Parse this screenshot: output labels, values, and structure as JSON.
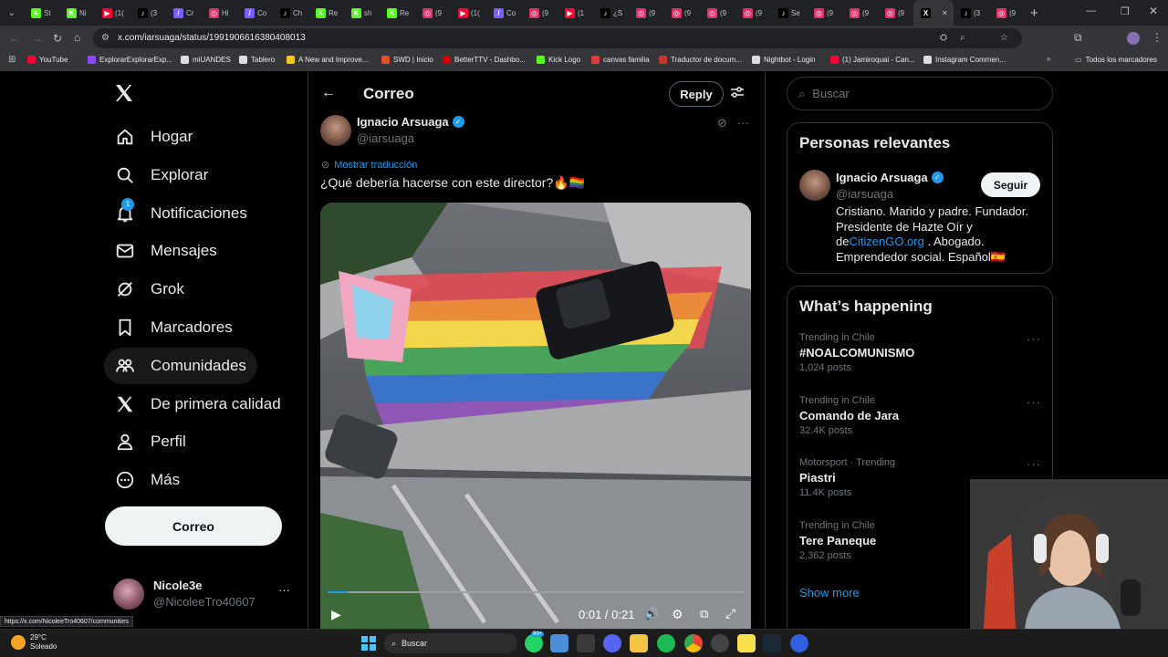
{
  "browser": {
    "tabs": [
      {
        "label": "St",
        "color": "#53fc18",
        "glyph": "K"
      },
      {
        "label": "Ni",
        "color": "#53fc18",
        "glyph": "K"
      },
      {
        "label": "(1(",
        "color": "#ff0033",
        "glyph": "▶"
      },
      {
        "label": "(3",
        "color": "#000000",
        "glyph": "♪"
      },
      {
        "label": "Cr",
        "color": "#7b5cff",
        "glyph": "/"
      },
      {
        "label": "Hi",
        "color": "#e1306c",
        "glyph": "◎"
      },
      {
        "label": "Co",
        "color": "#7b5cff",
        "glyph": "/"
      },
      {
        "label": "Ch",
        "color": "#000000",
        "glyph": "♪"
      },
      {
        "label": "Re",
        "color": "#53fc18",
        "glyph": "K"
      },
      {
        "label": "sh",
        "color": "#53fc18",
        "glyph": "K"
      },
      {
        "label": "Re",
        "color": "#53fc18",
        "glyph": "K"
      },
      {
        "label": "(9",
        "color": "#e1306c",
        "glyph": "◎"
      },
      {
        "label": "(1(",
        "color": "#ff0033",
        "glyph": "▶"
      },
      {
        "label": "Co",
        "color": "#7b5cff",
        "glyph": "/"
      },
      {
        "label": "(9",
        "color": "#e1306c",
        "glyph": "◎"
      },
      {
        "label": "(1",
        "color": "#ff0033",
        "glyph": "▶"
      },
      {
        "label": "¿S",
        "color": "#000000",
        "glyph": "♪"
      },
      {
        "label": "(9",
        "color": "#e1306c",
        "glyph": "◎"
      },
      {
        "label": "(9",
        "color": "#e1306c",
        "glyph": "◎"
      },
      {
        "label": "(9",
        "color": "#e1306c",
        "glyph": "◎"
      },
      {
        "label": "(9",
        "color": "#e1306c",
        "glyph": "◎"
      },
      {
        "label": "Se",
        "color": "#000000",
        "glyph": "♪"
      },
      {
        "label": "(9",
        "color": "#e1306c",
        "glyph": "◎"
      },
      {
        "label": "(9",
        "color": "#e1306c",
        "glyph": "◎"
      },
      {
        "label": "(9",
        "color": "#e1306c",
        "glyph": "◎"
      },
      {
        "label": "",
        "color": "#000000",
        "glyph": "X",
        "active": true
      },
      {
        "label": "(3",
        "color": "#000000",
        "glyph": "♪"
      },
      {
        "label": "(9",
        "color": "#e1306c",
        "glyph": "◎"
      }
    ],
    "url": "x.com/iarsuaga/status/1991906616380408013",
    "bookmarks": [
      {
        "label": "YouTube",
        "color": "#ff0033"
      },
      {
        "label": "ExplorarExplorarExp...",
        "color": "#9146ff"
      },
      {
        "label": "miUANDES",
        "color": "#dddddd"
      },
      {
        "label": "Tablero",
        "color": "#dddddd"
      },
      {
        "label": "A New and Improve...",
        "color": "#f5c518"
      },
      {
        "label": "SWD | Inicio",
        "color": "#e34f26"
      },
      {
        "label": "BetterTTV - Dashbo...",
        "color": "#d50000"
      },
      {
        "label": "Kick Logo",
        "color": "#53fc18"
      },
      {
        "label": "canvas familia",
        "color": "#e13a3a"
      },
      {
        "label": "Traductor de docum...",
        "color": "#c0392b"
      },
      {
        "label": "Nightbot - Login",
        "color": "#dddddd"
      },
      {
        "label": "(1) Jamiroquai - Can...",
        "color": "#ff0033"
      },
      {
        "label": "Instagram Commen...",
        "color": "#dddddd"
      }
    ],
    "all_bookmarks": "Todos los marcadores"
  },
  "sidebar": {
    "items": [
      {
        "label": "Hogar",
        "icon": "home-icon"
      },
      {
        "label": "Explorar",
        "icon": "search-icon"
      },
      {
        "label": "Notificaciones",
        "icon": "bell-icon"
      },
      {
        "label": "Mensajes",
        "icon": "mail-icon"
      },
      {
        "label": "Grok",
        "icon": "grok-icon"
      },
      {
        "label": "Marcadores",
        "icon": "bookmark-icon"
      },
      {
        "label": "Comunidades",
        "icon": "communities-icon"
      },
      {
        "label": "De primera calidad",
        "icon": "x-logo-icon"
      },
      {
        "label": "Perfil",
        "icon": "person-icon"
      },
      {
        "label": "Más",
        "icon": "more-circle-icon"
      }
    ],
    "notif_badge": "1",
    "post_button": "Correo",
    "account": {
      "name": "Nicole3e",
      "handle": "@NicoleeTro40607"
    }
  },
  "status_url": "https://x.com/NicoleeTro40607/communities",
  "main": {
    "header_title": "Correo",
    "reply_button": "Reply",
    "author": {
      "name": "Ignacio Arsuaga",
      "handle": "@iarsuaga"
    },
    "translate": "Mostrar traducción",
    "text": "¿Qué debería hacerse con este director?🔥🏳️‍🌈",
    "video": {
      "time": "0:01 / 0:21",
      "progress": 0.05
    }
  },
  "right": {
    "search_placeholder": "Buscar",
    "relevant_title": "Personas relevantes",
    "relevant": {
      "name": "Ignacio Arsuaga",
      "handle": "@iarsuaga",
      "follow": "Seguir",
      "bio_pre": "Cristiano. Marido y padre. Fundador. Presidente de Hazte Oír y de",
      "bio_link": "CitizenGO.org",
      "bio_post": " . Abogado. Emprendedor social. Español🇪🇸"
    },
    "happening_title": "What’s happening",
    "trends": [
      {
        "meta": "Trending in Chile",
        "name": "#NOALCOMUNISMO",
        "count": "1,024 posts"
      },
      {
        "meta": "Trending in Chile",
        "name": "Comando de Jara",
        "count": "32.4K posts"
      },
      {
        "meta": "Motorsport · Trending",
        "name": "Piastri",
        "count": "11.4K posts"
      },
      {
        "meta": "Trending in Chile",
        "name": "Tere Paneque",
        "count": "2,362 posts"
      }
    ],
    "show_more": "Show more"
  },
  "taskbar": {
    "weather_temp": "29°C",
    "weather_desc": "Soleado",
    "search": "Buscar",
    "badge": "99+"
  },
  "colors": {
    "accent": "#1d9bf0",
    "verified": "#1d9bf0",
    "bg": "#000000",
    "border": "#2f3336"
  }
}
